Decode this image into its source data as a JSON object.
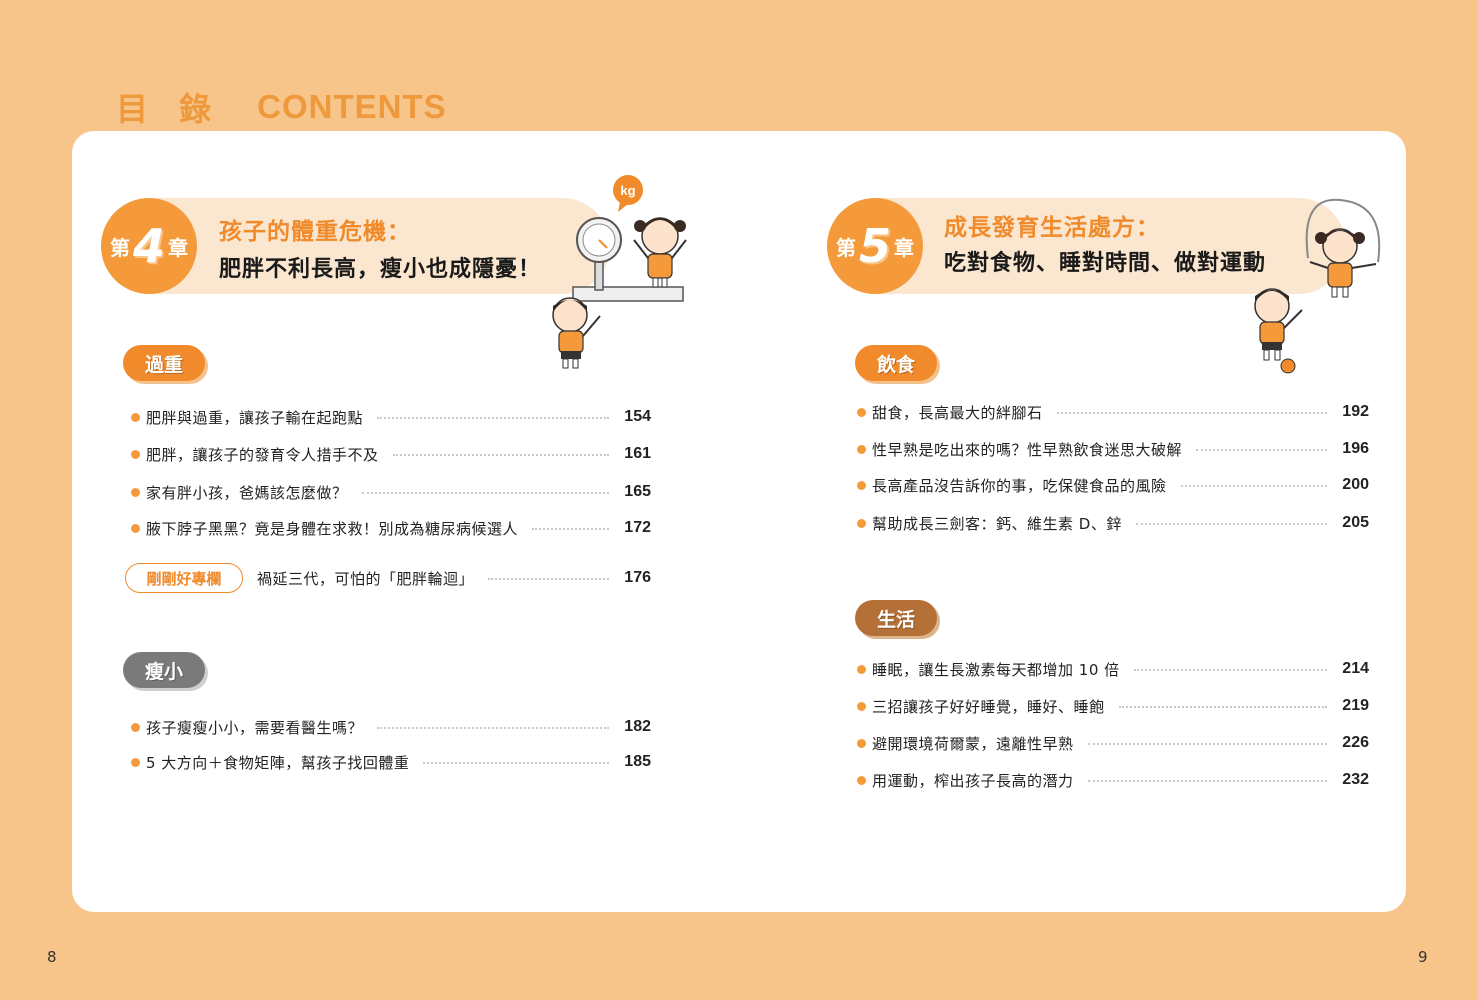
{
  "header": {
    "title_zh": "目 錄",
    "title_en": "CONTENTS"
  },
  "colors": {
    "background": "#f7c48a",
    "accent": "#f59a3a",
    "chapter_title": "#f08a2a"
  },
  "left_page": {
    "page_number": "8",
    "chapter": {
      "prefix": "第",
      "number": "4",
      "suffix": "章",
      "title_line1": "孩子的體重危機：",
      "title_line2": "肥胖不利長高，瘦小也成隱憂！",
      "illustration_label": "kg"
    },
    "sections": [
      {
        "tag": "過重",
        "entries": [
          {
            "text": "肥胖與過重，讓孩子輸在起跑點",
            "page": "154"
          },
          {
            "text": "肥胖，讓孩子的發育令人措手不及",
            "page": "161"
          },
          {
            "text": "家有胖小孩，爸媽該怎麼做？",
            "page": "165"
          },
          {
            "text": "腋下脖子黑黑？竟是身體在求救！別成為糖尿病候選人",
            "page": "172"
          }
        ],
        "column": {
          "label": "剛剛好專欄",
          "text": "禍延三代，可怕的「肥胖輪迴」",
          "page": "176"
        }
      },
      {
        "tag": "瘦小",
        "entries": [
          {
            "text": "孩子瘦瘦小小，需要看醫生嗎？",
            "page": "182"
          },
          {
            "text": "5 大方向＋食物矩陣，幫孩子找回體重",
            "page": "185"
          }
        ]
      }
    ]
  },
  "right_page": {
    "page_number": "9",
    "chapter": {
      "prefix": "第",
      "number": "5",
      "suffix": "章",
      "title_line1": "成長發育生活處方：",
      "title_line2": "吃對食物、睡對時間、做對運動"
    },
    "sections": [
      {
        "tag": "飲食",
        "entries": [
          {
            "text": "甜食，長高最大的絆腳石",
            "page": "192"
          },
          {
            "text": "性早熟是吃出來的嗎？性早熟飲食迷思大破解",
            "page": "196"
          },
          {
            "text": "長高產品沒告訴你的事，吃保健食品的風險",
            "page": "200"
          },
          {
            "text": "幫助成長三劍客：鈣、維生素 D、鋅",
            "page": "205"
          }
        ]
      },
      {
        "tag": "生活",
        "entries": [
          {
            "text": "睡眠，讓生長激素每天都增加 10 倍",
            "page": "214"
          },
          {
            "text": "三招讓孩子好好睡覺，睡好、睡飽",
            "page": "219"
          },
          {
            "text": "避開環境荷爾蒙，遠離性早熟",
            "page": "226"
          },
          {
            "text": "用運動，榨出孩子長高的潛力",
            "page": "232"
          }
        ]
      }
    ]
  }
}
